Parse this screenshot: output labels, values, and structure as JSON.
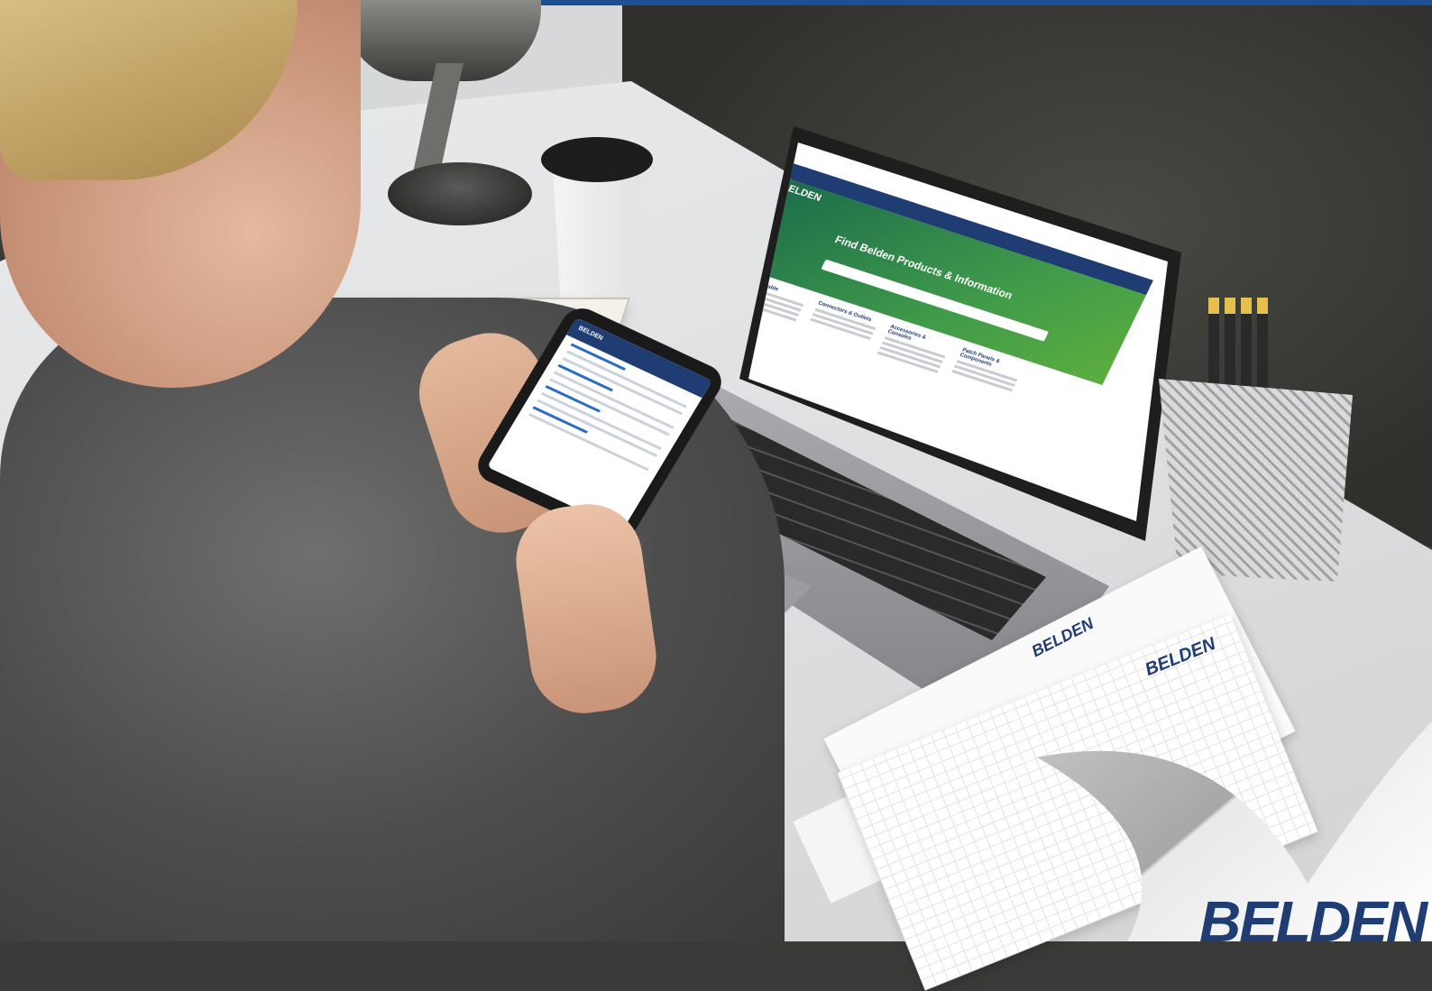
{
  "colors": {
    "top_bar": "#1f4f93",
    "brand_blue": "#1f3c73",
    "screen_green": "#3f9a4a"
  },
  "laptop_screen": {
    "brand": "BELDEN",
    "hero_title": "Find Belden Products & Information",
    "categories": [
      "Wire & Cable",
      "Connectors & Outlets",
      "Accessories & Consoles",
      "Patch Panels & Components"
    ]
  },
  "phone_screen": {
    "brand": "BELDEN"
  },
  "papers": {
    "logo_1": "BELDEN",
    "logo_2": "BELDEN"
  },
  "corner_brand": "BELDEN"
}
